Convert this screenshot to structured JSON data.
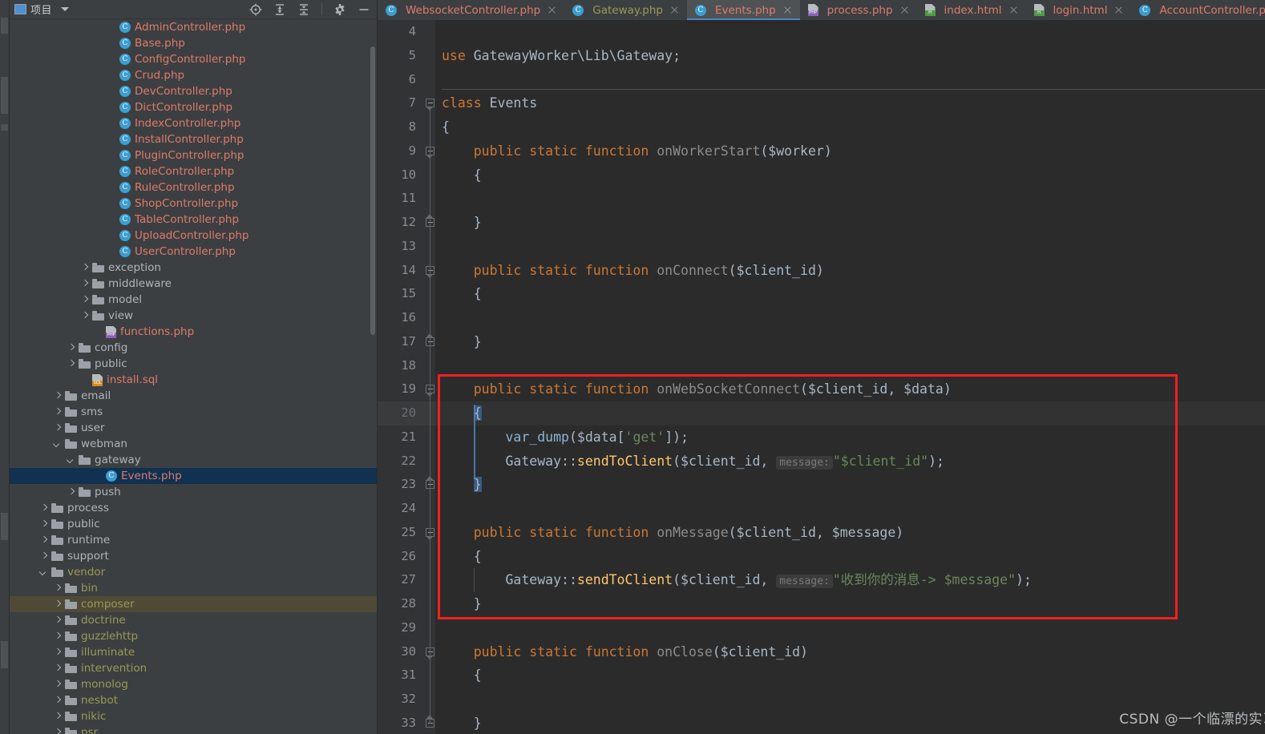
{
  "window": {
    "theme_bg": "#3c3f41",
    "editor_bg": "#2b2b2b",
    "accent": "#4a88c7",
    "highlight_box_color": "#f51f1f"
  },
  "project_panel": {
    "title": "项目",
    "project_icon": "project-icon",
    "dropdown_icon": "chevron-down-icon",
    "actions": [
      {
        "name": "select-opened-file-icon",
        "glyph": "locate"
      },
      {
        "name": "expand-all-icon",
        "glyph": "expand-all"
      },
      {
        "name": "collapse-all-icon",
        "glyph": "collapse-all"
      },
      {
        "name": "settings-gear-icon",
        "glyph": "gear"
      },
      {
        "name": "hide-panel-icon",
        "glyph": "minus"
      }
    ],
    "tree": [
      {
        "label": "AdminController.php",
        "icon": "php-class-icon",
        "indent": 7,
        "arrow": "none",
        "color": "red"
      },
      {
        "label": "Base.php",
        "icon": "php-class-icon",
        "indent": 7,
        "arrow": "none",
        "color": "red"
      },
      {
        "label": "ConfigController.php",
        "icon": "php-class-icon",
        "indent": 7,
        "arrow": "none",
        "color": "red"
      },
      {
        "label": "Crud.php",
        "icon": "php-class-icon",
        "indent": 7,
        "arrow": "none",
        "color": "red"
      },
      {
        "label": "DevController.php",
        "icon": "php-class-icon",
        "indent": 7,
        "arrow": "none",
        "color": "red"
      },
      {
        "label": "DictController.php",
        "icon": "php-class-icon",
        "indent": 7,
        "arrow": "none",
        "color": "red"
      },
      {
        "label": "IndexController.php",
        "icon": "php-class-icon",
        "indent": 7,
        "arrow": "none",
        "color": "red"
      },
      {
        "label": "InstallController.php",
        "icon": "php-class-icon",
        "indent": 7,
        "arrow": "none",
        "color": "red"
      },
      {
        "label": "PluginController.php",
        "icon": "php-class-icon",
        "indent": 7,
        "arrow": "none",
        "color": "red"
      },
      {
        "label": "RoleController.php",
        "icon": "php-class-icon",
        "indent": 7,
        "arrow": "none",
        "color": "red"
      },
      {
        "label": "RuleController.php",
        "icon": "php-class-icon",
        "indent": 7,
        "arrow": "none",
        "color": "red"
      },
      {
        "label": "ShopController.php",
        "icon": "php-class-icon",
        "indent": 7,
        "arrow": "none",
        "color": "red"
      },
      {
        "label": "TableController.php",
        "icon": "php-class-icon",
        "indent": 7,
        "arrow": "none",
        "color": "red"
      },
      {
        "label": "UploadController.php",
        "icon": "php-class-icon",
        "indent": 7,
        "arrow": "none",
        "color": "red"
      },
      {
        "label": "UserController.php",
        "icon": "php-class-icon",
        "indent": 7,
        "arrow": "none",
        "color": "red"
      },
      {
        "label": "exception",
        "icon": "folder-icon",
        "indent": 5,
        "arrow": "collapsed",
        "color": "grey"
      },
      {
        "label": "middleware",
        "icon": "folder-icon",
        "indent": 5,
        "arrow": "collapsed",
        "color": "grey"
      },
      {
        "label": "model",
        "icon": "folder-icon",
        "indent": 5,
        "arrow": "collapsed",
        "color": "grey"
      },
      {
        "label": "view",
        "icon": "folder-icon",
        "indent": 5,
        "arrow": "collapsed",
        "color": "grey"
      },
      {
        "label": "functions.php",
        "icon": "php-file-icon",
        "indent": 6,
        "arrow": "none",
        "color": "red"
      },
      {
        "label": "config",
        "icon": "folder-icon",
        "indent": 4,
        "arrow": "collapsed",
        "color": "grey"
      },
      {
        "label": "public",
        "icon": "folder-icon",
        "indent": 4,
        "arrow": "collapsed",
        "color": "grey"
      },
      {
        "label": "install.sql",
        "icon": "sql-file-icon",
        "indent": 5,
        "arrow": "none",
        "color": "red"
      },
      {
        "label": "email",
        "icon": "folder-icon",
        "indent": 3,
        "arrow": "collapsed",
        "color": "grey"
      },
      {
        "label": "sms",
        "icon": "folder-icon",
        "indent": 3,
        "arrow": "collapsed",
        "color": "grey"
      },
      {
        "label": "user",
        "icon": "folder-icon",
        "indent": 3,
        "arrow": "collapsed",
        "color": "grey"
      },
      {
        "label": "webman",
        "icon": "folder-icon",
        "indent": 3,
        "arrow": "expanded",
        "color": "grey"
      },
      {
        "label": "gateway",
        "icon": "folder-icon",
        "indent": 4,
        "arrow": "expanded",
        "color": "grey"
      },
      {
        "label": "Events.php",
        "icon": "php-class-icon",
        "indent": 6,
        "arrow": "none",
        "color": "red",
        "state": "selected"
      },
      {
        "label": "push",
        "icon": "folder-icon",
        "indent": 4,
        "arrow": "collapsed",
        "color": "grey"
      },
      {
        "label": "process",
        "icon": "folder-icon",
        "indent": 2,
        "arrow": "collapsed",
        "color": "grey"
      },
      {
        "label": "public",
        "icon": "folder-icon",
        "indent": 2,
        "arrow": "collapsed",
        "color": "grey"
      },
      {
        "label": "runtime",
        "icon": "folder-icon",
        "indent": 2,
        "arrow": "collapsed",
        "color": "grey"
      },
      {
        "label": "support",
        "icon": "folder-icon",
        "indent": 2,
        "arrow": "collapsed",
        "color": "grey"
      },
      {
        "label": "vendor",
        "icon": "folder-icon",
        "indent": 2,
        "arrow": "expanded",
        "color": "olive"
      },
      {
        "label": "bin",
        "icon": "folder-icon",
        "indent": 3,
        "arrow": "collapsed",
        "color": "olive"
      },
      {
        "label": "composer",
        "icon": "folder-icon",
        "indent": 3,
        "arrow": "collapsed",
        "color": "olive",
        "state": "hover"
      },
      {
        "label": "doctrine",
        "icon": "folder-icon",
        "indent": 3,
        "arrow": "collapsed",
        "color": "olive"
      },
      {
        "label": "guzzlehttp",
        "icon": "folder-icon",
        "indent": 3,
        "arrow": "collapsed",
        "color": "olive"
      },
      {
        "label": "illuminate",
        "icon": "folder-icon",
        "indent": 3,
        "arrow": "collapsed",
        "color": "olive"
      },
      {
        "label": "intervention",
        "icon": "folder-icon",
        "indent": 3,
        "arrow": "collapsed",
        "color": "olive"
      },
      {
        "label": "monolog",
        "icon": "folder-icon",
        "indent": 3,
        "arrow": "collapsed",
        "color": "olive"
      },
      {
        "label": "nesbot",
        "icon": "folder-icon",
        "indent": 3,
        "arrow": "collapsed",
        "color": "olive"
      },
      {
        "label": "nikic",
        "icon": "folder-icon",
        "indent": 3,
        "arrow": "collapsed",
        "color": "olive"
      },
      {
        "label": "psr",
        "icon": "folder-icon",
        "indent": 3,
        "arrow": "collapsed",
        "color": "olive"
      }
    ]
  },
  "editor": {
    "tabs": [
      {
        "label": "WebsocketController.php",
        "icon": "php-class-icon",
        "color": "red",
        "active": false
      },
      {
        "label": "Gateway.php",
        "icon": "php-class-icon",
        "color": "olive",
        "active": false
      },
      {
        "label": "Events.php",
        "icon": "php-class-icon",
        "color": "red",
        "active": true
      },
      {
        "label": "process.php",
        "icon": "php-file-icon",
        "color": "red",
        "active": false
      },
      {
        "label": "index.html",
        "icon": "html-file-icon",
        "color": "red",
        "active": false
      },
      {
        "label": "login.html",
        "icon": "html-file-icon",
        "color": "red",
        "active": false
      },
      {
        "label": "AccountController.php",
        "icon": "php-class-icon",
        "color": "red",
        "active": false
      }
    ],
    "current_line": 20,
    "lines": [
      {
        "n": 4,
        "tokens": []
      },
      {
        "n": 5,
        "tokens": [
          {
            "t": "use ",
            "c": "kw"
          },
          {
            "t": "GatewayWorker\\Lib\\Gateway;",
            "c": "id"
          }
        ]
      },
      {
        "n": 6,
        "tokens": []
      },
      {
        "n": 7,
        "tokens": [
          {
            "t": "class ",
            "c": "kw"
          },
          {
            "t": "Events",
            "c": "id"
          }
        ],
        "fold": "open",
        "separator": true
      },
      {
        "n": 8,
        "tokens": [
          {
            "t": "{",
            "c": "punct"
          }
        ]
      },
      {
        "n": 9,
        "tokens": [
          {
            "t": "    ",
            "c": "id"
          },
          {
            "t": "public static function ",
            "c": "kw"
          },
          {
            "t": "onWorkerStart",
            "c": "mth"
          },
          {
            "t": "($worker)",
            "c": "id"
          }
        ],
        "fold": "open"
      },
      {
        "n": 10,
        "tokens": [
          {
            "t": "    {",
            "c": "punct"
          }
        ]
      },
      {
        "n": 11,
        "tokens": []
      },
      {
        "n": 12,
        "tokens": [
          {
            "t": "    }",
            "c": "punct"
          }
        ],
        "fold": "close"
      },
      {
        "n": 13,
        "tokens": []
      },
      {
        "n": 14,
        "tokens": [
          {
            "t": "    ",
            "c": "id"
          },
          {
            "t": "public static function ",
            "c": "kw"
          },
          {
            "t": "onConnect",
            "c": "mth"
          },
          {
            "t": "($client_id)",
            "c": "id"
          }
        ],
        "fold": "open"
      },
      {
        "n": 15,
        "tokens": [
          {
            "t": "    {",
            "c": "punct"
          }
        ]
      },
      {
        "n": 16,
        "tokens": []
      },
      {
        "n": 17,
        "tokens": [
          {
            "t": "    }",
            "c": "punct"
          }
        ],
        "fold": "close"
      },
      {
        "n": 18,
        "tokens": []
      },
      {
        "n": 19,
        "tokens": [
          {
            "t": "    ",
            "c": "id"
          },
          {
            "t": "public static function ",
            "c": "kw"
          },
          {
            "t": "onWebSocketConnect",
            "c": "mth"
          },
          {
            "t": "($client_id, $data)",
            "c": "id"
          }
        ],
        "fold": "open"
      },
      {
        "n": 20,
        "tokens": [
          {
            "t": "    ",
            "c": "id"
          },
          {
            "t": "{",
            "c": "brace"
          }
        ]
      },
      {
        "n": 21,
        "tokens": [
          {
            "t": "        ",
            "c": "id"
          },
          {
            "t": "var_dump",
            "c": "bif"
          },
          {
            "t": "($data[",
            "c": "id"
          },
          {
            "t": "'get'",
            "c": "str"
          },
          {
            "t": "]);",
            "c": "id"
          }
        ]
      },
      {
        "n": 22,
        "tokens": [
          {
            "t": "        Gateway",
            "c": "id"
          },
          {
            "t": "::",
            "c": "id"
          },
          {
            "t": "sendToClient",
            "c": "fn"
          },
          {
            "t": "($client_id, ",
            "c": "id"
          },
          {
            "t": "message:",
            "c": "hint"
          },
          {
            "t": "\"$client_id\"",
            "c": "str2"
          },
          {
            "t": ");",
            "c": "id"
          }
        ]
      },
      {
        "n": 23,
        "tokens": [
          {
            "t": "    ",
            "c": "id"
          },
          {
            "t": "}",
            "c": "brace"
          }
        ],
        "fold": "close"
      },
      {
        "n": 24,
        "tokens": []
      },
      {
        "n": 25,
        "tokens": [
          {
            "t": "    ",
            "c": "id"
          },
          {
            "t": "public static function ",
            "c": "kw"
          },
          {
            "t": "onMessage",
            "c": "mth"
          },
          {
            "t": "($client_id, $message)",
            "c": "id"
          }
        ],
        "fold": "open"
      },
      {
        "n": 26,
        "tokens": [
          {
            "t": "    {",
            "c": "punct"
          }
        ]
      },
      {
        "n": 27,
        "tokens": [
          {
            "t": "        Gateway",
            "c": "id"
          },
          {
            "t": "::",
            "c": "id"
          },
          {
            "t": "sendToClient",
            "c": "fn"
          },
          {
            "t": "($client_id, ",
            "c": "id"
          },
          {
            "t": "message:",
            "c": "hint"
          },
          {
            "t": "\"收到你的消息-> $message\"",
            "c": "str"
          },
          {
            "t": ");",
            "c": "id"
          }
        ]
      },
      {
        "n": 28,
        "tokens": [
          {
            "t": "    }",
            "c": "punct"
          }
        ]
      },
      {
        "n": 29,
        "tokens": []
      },
      {
        "n": 30,
        "tokens": [
          {
            "t": "    ",
            "c": "id"
          },
          {
            "t": "public static function ",
            "c": "kw"
          },
          {
            "t": "onClose",
            "c": "mth"
          },
          {
            "t": "($client_id)",
            "c": "id"
          }
        ],
        "fold": "open"
      },
      {
        "n": 31,
        "tokens": [
          {
            "t": "    {",
            "c": "punct"
          }
        ]
      },
      {
        "n": 32,
        "tokens": []
      },
      {
        "n": 33,
        "tokens": [
          {
            "t": "    }",
            "c": "punct"
          }
        ],
        "fold": "close"
      }
    ]
  },
  "watermark": "CSDN @一个临漂的实习生"
}
